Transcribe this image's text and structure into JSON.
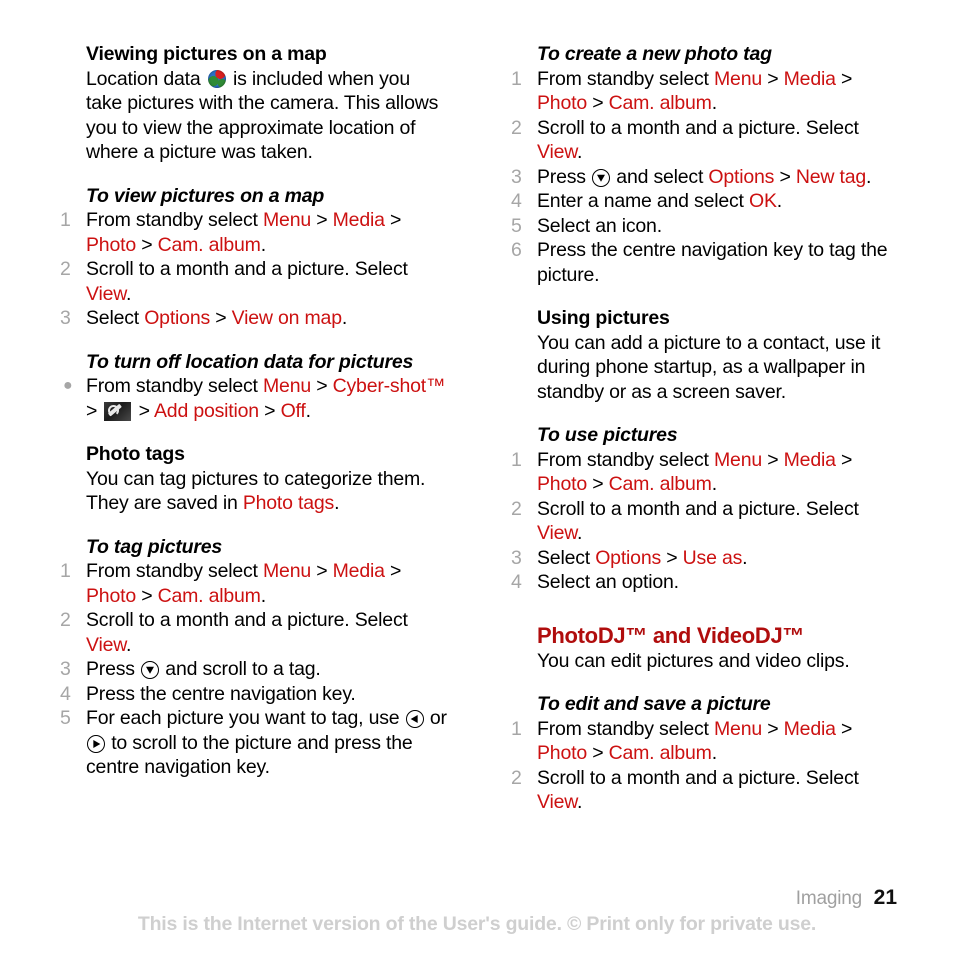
{
  "page": {
    "chapter": "Imaging",
    "number": "21",
    "disclaimer": "This is the Internet version of the User's guide. © Print only for private use."
  },
  "icons": {
    "globe": "globe-icon",
    "wrench": "wrench-icon",
    "nav_down": "navigation-down-icon",
    "nav_left": "navigation-left-icon",
    "nav_right": "navigation-right-icon"
  },
  "separator": ">",
  "left_column": {
    "viewing_pictures": {
      "heading": "Viewing pictures on a map",
      "body_part1": "Location data",
      "body_part2": "is included when you take pictures with the camera. This allows you to view the approximate location of where a picture was taken."
    },
    "to_view_pictures": {
      "heading": "To view pictures on a map",
      "steps": [
        {
          "num": "1",
          "t1": "From standby select",
          "l1": "Menu",
          "l2": "Media",
          "l3": "Photo",
          "l4": "Cam. album",
          "t2": "."
        },
        {
          "num": "2",
          "t1": "Scroll to a month and a picture. Select",
          "l1": "View",
          "t2": "."
        },
        {
          "num": "3",
          "t1": "Select",
          "l1": "Options",
          "l2": "View on map",
          "t2": "."
        }
      ]
    },
    "to_turn_off": {
      "heading": "To turn off location data for pictures",
      "bullet": {
        "t1": "From standby select",
        "l1": "Menu",
        "l2": "Cyber-shot™",
        "l3": "Add position",
        "l4": "Off",
        "t2": "."
      }
    },
    "photo_tags": {
      "heading": "Photo tags",
      "body_part1": "You can tag pictures to categorize them. They are saved in",
      "body_link": "Photo tags",
      "body_part2": "."
    },
    "to_tag_pictures": {
      "heading": "To tag pictures",
      "steps": [
        {
          "num": "1",
          "t1": "From standby select",
          "l1": "Menu",
          "l2": "Media",
          "l3": "Photo",
          "l4": "Cam. album",
          "t2": "."
        },
        {
          "num": "2",
          "t1": "Scroll to a month and a picture. Select",
          "l1": "View",
          "t2": "."
        },
        {
          "num": "3",
          "t1": "Press",
          "t2": "and scroll to a tag."
        },
        {
          "num": "4",
          "t1": "Press the centre navigation key."
        },
        {
          "num": "5",
          "t1": "For each picture you want to tag, use",
          "t2": "or",
          "t3": "to scroll to the picture and press the centre navigation key."
        }
      ]
    }
  },
  "right_column": {
    "to_create_tag": {
      "heading": "To create a new photo tag",
      "steps": [
        {
          "num": "1",
          "t1": "From standby select",
          "l1": "Menu",
          "l2": "Media",
          "l3": "Photo",
          "l4": "Cam. album",
          "t2": "."
        },
        {
          "num": "2",
          "t1": "Scroll to a month and a picture. Select",
          "l1": "View",
          "t2": "."
        },
        {
          "num": "3",
          "t1": "Press",
          "t2": "and select",
          "l1": "Options",
          "l2": "New tag",
          "t3": "."
        },
        {
          "num": "4",
          "t1": "Enter a name and select",
          "l1": "OK",
          "t2": "."
        },
        {
          "num": "5",
          "t1": "Select an icon."
        },
        {
          "num": "6",
          "t1": "Press the centre navigation key to tag the picture."
        }
      ]
    },
    "using_pictures": {
      "heading": "Using pictures",
      "body": "You can add a picture to a contact, use it during phone startup, as a wallpaper in standby or as a screen saver."
    },
    "to_use_pictures": {
      "heading": "To use pictures",
      "steps": [
        {
          "num": "1",
          "t1": "From standby select",
          "l1": "Menu",
          "l2": "Media",
          "l3": "Photo",
          "l4": "Cam. album",
          "t2": "."
        },
        {
          "num": "2",
          "t1": "Scroll to a month and a picture. Select",
          "l1": "View",
          "t2": "."
        },
        {
          "num": "3",
          "t1": "Select",
          "l1": "Options",
          "l2": "Use as",
          "t2": "."
        },
        {
          "num": "4",
          "t1": "Select an option."
        }
      ]
    },
    "photodj": {
      "heading": "PhotoDJ™ and VideoDJ™",
      "body": "You can edit pictures and video clips."
    },
    "to_edit_save": {
      "heading": "To edit and save a picture",
      "steps": [
        {
          "num": "1",
          "t1": "From standby select",
          "l1": "Menu",
          "l2": "Media",
          "l3": "Photo",
          "l4": "Cam. album",
          "t2": "."
        },
        {
          "num": "2",
          "t1": "Scroll to a month and a picture. Select",
          "l1": "View",
          "t2": "."
        }
      ]
    }
  },
  "colors": {
    "link": "#cc1111",
    "heading_accent": "#b00d0d",
    "number": "#a6a6a6",
    "footer_note": "#cfcfcf",
    "chapter": "#a0a0a0"
  }
}
